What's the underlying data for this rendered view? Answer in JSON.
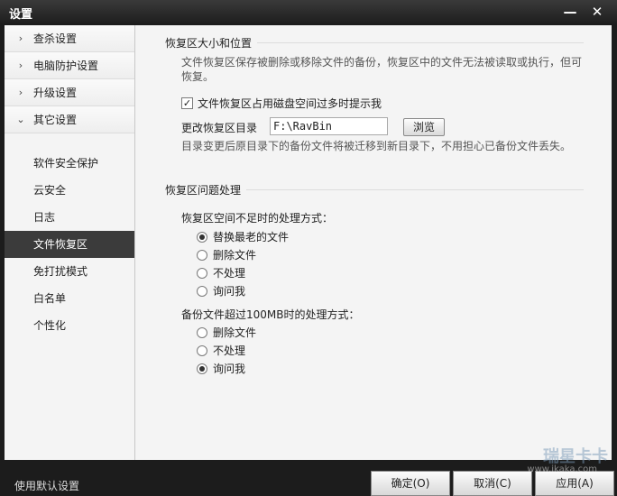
{
  "window": {
    "title": "设置",
    "min_glyph": "—",
    "close_glyph": "✕"
  },
  "sidebar": {
    "groups": [
      {
        "label": "查杀设置",
        "arrow": "›"
      },
      {
        "label": "电脑防护设置",
        "arrow": "›"
      },
      {
        "label": "升级设置",
        "arrow": "›"
      },
      {
        "label": "其它设置",
        "arrow": "⌄"
      }
    ],
    "items": [
      {
        "label": "软件安全保护"
      },
      {
        "label": "云安全"
      },
      {
        "label": "日志"
      },
      {
        "label": "文件恢复区"
      },
      {
        "label": "免打扰模式"
      },
      {
        "label": "白名单"
      },
      {
        "label": "个性化"
      }
    ]
  },
  "main": {
    "section1": {
      "title": "恢复区大小和位置",
      "desc": "文件恢复区保存被删除或移除文件的备份，恢复区中的文件无法被读取或执行，但可恢复。",
      "warn_checkbox": {
        "label": "文件恢复区占用磁盘空间过多时提示我",
        "checked": "✓"
      },
      "path_label": "更改恢复区目录",
      "path_value": "F:\\RavBin",
      "browse_label": "浏览",
      "path_note": "目录变更后原目录下的备份文件将被迁移到新目录下，不用担心已备份文件丢失。"
    },
    "section2": {
      "title": "恢复区问题处理",
      "q1": "恢复区空间不足时的处理方式：",
      "q1_options": [
        "替换最老的文件",
        "删除文件",
        "不处理",
        "询问我"
      ],
      "q1_selected_index": 0,
      "q2": "备份文件超过100MB时的处理方式：",
      "q2_options": [
        "删除文件",
        "不处理",
        "询问我"
      ],
      "q2_selected_index": 2
    }
  },
  "footer": {
    "default_label": "使用默认设置",
    "ok_label": "确定(O)",
    "cancel_label": "取消(C)",
    "apply_label": "应用(A)",
    "watermark": "瑞星卡卡",
    "watermark_url": "www.ikaka.com"
  }
}
